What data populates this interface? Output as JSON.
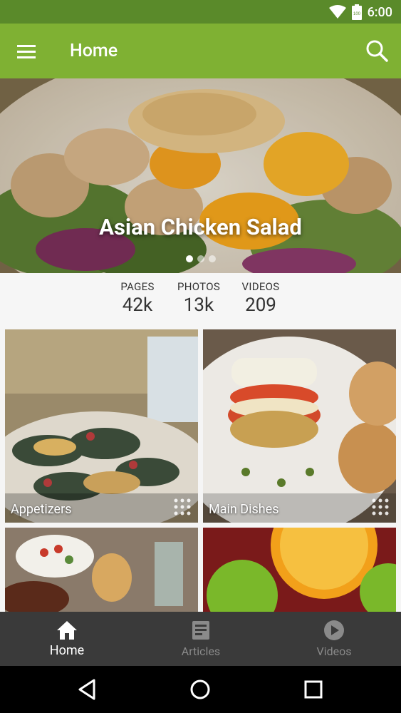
{
  "status_bar": {
    "time": "6:00",
    "battery_level": "100"
  },
  "app_bar": {
    "title": "Home"
  },
  "hero": {
    "title": "Asian Chicken Salad",
    "slide_count": 3,
    "active_slide": 1
  },
  "stats": [
    {
      "label": "PAGES",
      "value": "42k"
    },
    {
      "label": "PHOTOS",
      "value": "13k"
    },
    {
      "label": "VIDEOS",
      "value": "209"
    }
  ],
  "tiles": [
    {
      "label": "Appetizers"
    },
    {
      "label": "Main Dishes"
    },
    {
      "label": ""
    },
    {
      "label": ""
    }
  ],
  "bottom_nav": [
    {
      "label": "Home",
      "icon": "home-icon",
      "active": true
    },
    {
      "label": "Articles",
      "icon": "articles-icon",
      "active": false
    },
    {
      "label": "Videos",
      "icon": "play-circle-icon",
      "active": false
    }
  ],
  "colors": {
    "primary": "#7fb133",
    "primary_dark": "#5a8a2a",
    "nav_bg": "#3a3a3a",
    "nav_active": "#ffffff",
    "nav_inactive": "#8a8a8a"
  }
}
